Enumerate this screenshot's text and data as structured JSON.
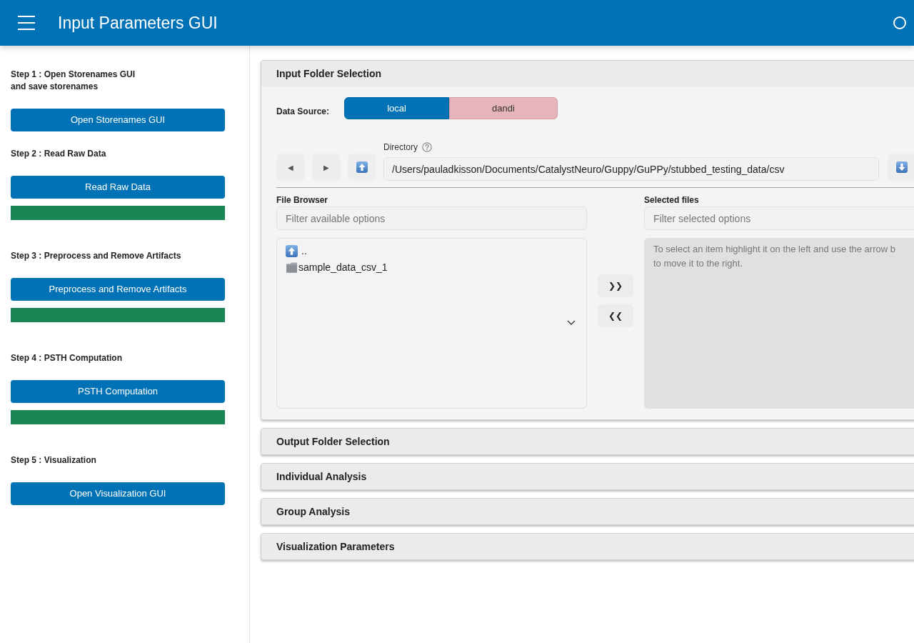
{
  "header": {
    "title": "Input Parameters GUI"
  },
  "sidebar": {
    "steps": [
      {
        "label": "Step 1 : Open Storenames GUI\nand save storenames",
        "button": "Open Storenames GUI"
      },
      {
        "label": "Step 2 : Read Raw Data",
        "button": "Read Raw Data",
        "progress": {
          "level": 1
        }
      },
      {
        "label": "Step 3 : Preprocess and Remove Artifacts",
        "button": "Preprocess and Remove Artifacts",
        "progress": {
          "level": 1
        }
      },
      {
        "label": "Step 4 : PSTH Computation",
        "button": "PSTH Computation",
        "progress": {
          "level": 1
        }
      },
      {
        "label": "Step 5 : Visualization",
        "button": "Open Visualization GUI"
      }
    ]
  },
  "sections": [
    {
      "title": "Input Folder Selection",
      "expanded": true,
      "content": {
        "data_source": {
          "label": "Data Source:",
          "options": [
            {
              "label": "local",
              "selected": true
            },
            {
              "label": "dandi",
              "selected": false
            }
          ]
        },
        "directory": {
          "label": "Directory",
          "value": "/Users/pauladkisson/Documents/CatalystNeuro/Guppy/GuPPy/stubbed_testing_data/csv",
          "nav_buttons": [
            "◀",
            "▶"
          ]
        },
        "file_browser": {
          "label": "File Browser",
          "filter": {
            "placeholder": "Filter available options"
          },
          "items": [
            {
              "label": "..",
              "kind": "parent",
              "selected": false
            },
            {
              "label": "sample_data_csv_1",
              "kind": "folder",
              "selected": false
            }
          ]
        },
        "transfer_buttons": [
          "❯❯",
          "❮❮"
        ],
        "selected_files": {
          "label": "Selected files",
          "filter": {
            "placeholder": "Filter selected options"
          },
          "hint": "To select an item highlight it on the left and use the arrow b\nto move it to the right."
        }
      }
    },
    {
      "title": "Output Folder Selection",
      "expanded": false
    },
    {
      "title": "Individual Analysis",
      "expanded": false
    },
    {
      "title": "Group Analysis",
      "expanded": false
    },
    {
      "title": "Visualization Parameters",
      "expanded": false
    }
  ]
}
